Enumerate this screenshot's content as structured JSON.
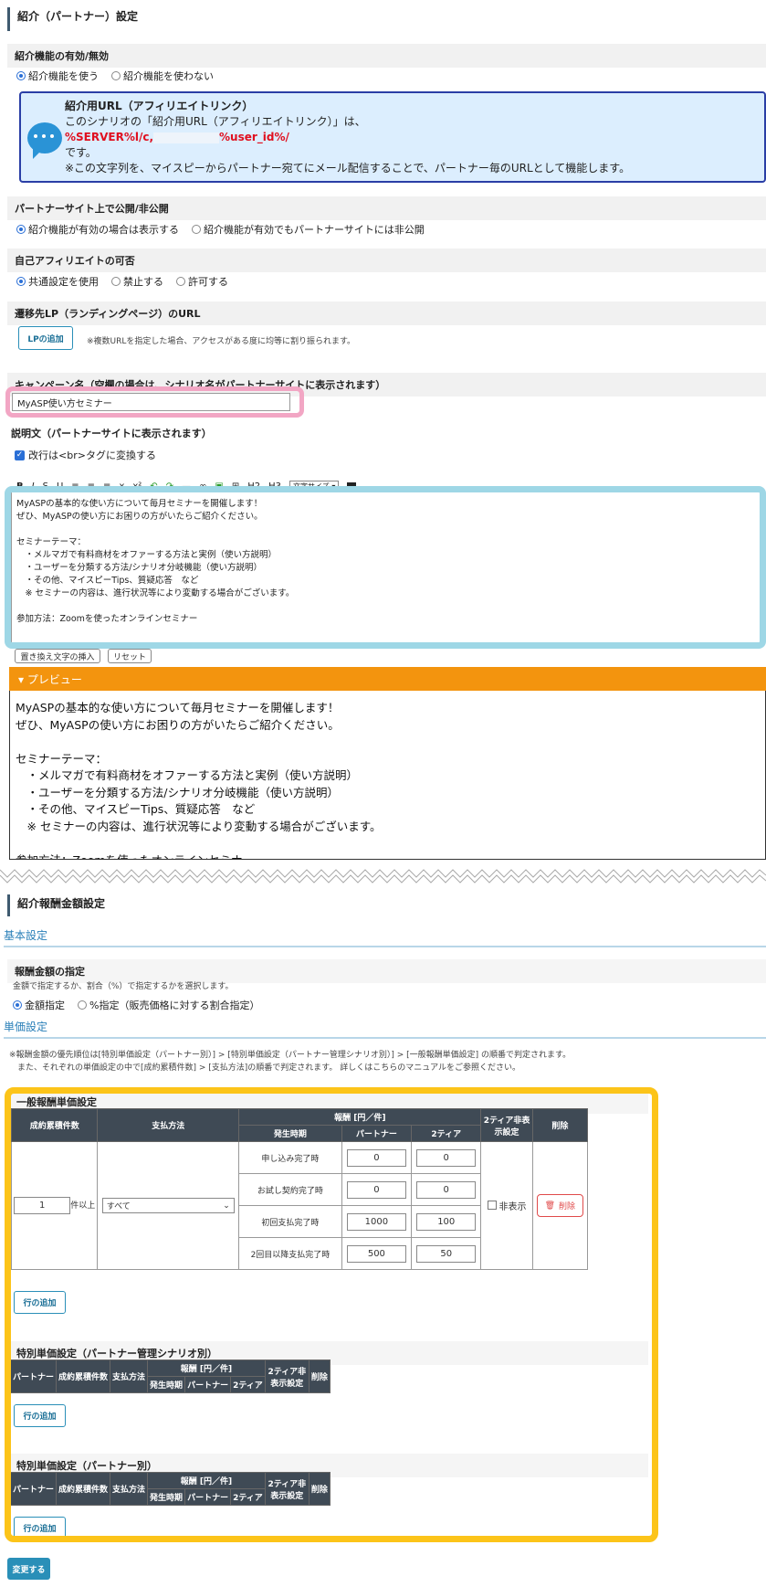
{
  "section1": {
    "title": "紹介（パートナー）設定",
    "enable": {
      "label": "紹介機能の有効/無効",
      "options": [
        "紹介機能を使う",
        "紹介機能を使わない"
      ],
      "selected": 0
    },
    "info": {
      "heading": "紹介用URL（アフィリエイトリンク）",
      "line1": "このシナリオの「紹介用URL（アフィリエイトリンク）」は、",
      "url_part1": "%SERVER%l/c,",
      "url_part2": "%user_id%/",
      "line3": "です。",
      "line4": "※この文字列を、マイスピーからパートナー宛てにメール配信することで、パートナー毎のURLとして機能します。"
    },
    "publish": {
      "label": "パートナーサイト上で公開/非公開",
      "options": [
        "紹介機能が有効の場合は表示する",
        "紹介機能が有効でもパートナーサイトには非公開"
      ],
      "selected": 0
    },
    "self_affiliate": {
      "label": "自己アフィリエイトの可否",
      "options": [
        "共通設定を使用",
        "禁止する",
        "許可する"
      ],
      "selected": 0
    },
    "lp": {
      "label": "遷移先LP（ランディングページ）のURL",
      "button": "LPの追加",
      "note": "※複数URLを指定した場合、アクセスがある度に均等に割り振られます。"
    },
    "campaign": {
      "label": "キャンペーン名（空欄の場合は、シナリオ名がパートナーサイトに表示されます）",
      "value": "MyASP使い方セミナー"
    },
    "description": {
      "label": "説明文（パートナーサイトに表示されます）",
      "br_checkbox": "改行は<br>タグに変換する",
      "toolbar": [
        "B",
        "I",
        "S",
        "U",
        "≡",
        "≡",
        "≡",
        "x",
        "x²",
        "↶",
        "↷",
        "—",
        "∞",
        "▣",
        "⊞",
        "H2",
        "H3"
      ],
      "font_select": "文字サイズ",
      "text": "MyASPの基本的な使い方について毎月セミナーを開催します！\nぜひ、MyASPの使い方にお困りの方がいたらご紹介ください。\n\nセミナーテーマ：\n　・メルマガで有料商材をオファーする方法と実例（使い方説明）\n　・ユーザーを分類する方法/シナリオ分岐機能（使い方説明）\n　・その他、マイスピーTips、質疑応答　など\n　※ セミナーの内容は、進行状況等により変動する場合がございます。\n\n参加方法：Zoomを使ったオンラインセミナー",
      "insert_button": "置き換え文字の挿入",
      "reset_button": "リセット"
    },
    "preview": {
      "title": "プレビュー",
      "text": "MyASPの基本的な使い方について毎月セミナーを開催します！\nぜひ、MyASPの使い方にお困りの方がいたらご紹介ください。\n\nセミナーテーマ：\n　・メルマガで有料商材をオファーする方法と実例（使い方説明）\n　・ユーザーを分類する方法/シナリオ分岐機能（使い方説明）\n　・その他、マイスピーTips、質疑応答　など\n　※ セミナーの内容は、進行状況等により変動する場合がございます。\n\n参加方法：Zoomを使ったオンラインセミナー"
    }
  },
  "section2": {
    "title": "紹介報酬金額設定",
    "basic_heading": "基本設定",
    "amount": {
      "label": "報酬金額の指定",
      "note": "金額で指定するか、割合（%）で指定するかを選択します。",
      "options": [
        "金額指定",
        "%指定（販売価格に対する割合指定）"
      ],
      "selected": 0
    },
    "unit_heading": "単価設定",
    "unit_note": "※報酬金額の優先順位は[特別単価設定（パートナー別）] > [特別単価設定（パートナー管理シナリオ別）] > [一般報酬単価設定] の順番で判定されます。\n　また、それぞれの単価設定の中で[成約累積件数] > [支払方法]の順番で判定されます。 詳しくはこちらのマニュアルをご参照ください。",
    "general": {
      "label": "一般報酬単価設定",
      "headers": {
        "count": "成約累積件数",
        "method": "支払方法",
        "reward": "報酬 [円／件]",
        "timing": "発生時期",
        "partner": "パートナー",
        "tier2": "2ティア",
        "hide": "2ティア非表示設定",
        "delete": "削除"
      },
      "count_value": "1",
      "count_suffix": "件以上",
      "method_value": "すべて",
      "rows": [
        {
          "timing": "申し込み完了時",
          "partner": "0",
          "tier2": "0"
        },
        {
          "timing": "お試し契約完了時",
          "partner": "0",
          "tier2": "0"
        },
        {
          "timing": "初回支払完了時",
          "partner": "1000",
          "tier2": "100"
        },
        {
          "timing": "2回目以降支払完了時",
          "partner": "500",
          "tier2": "50"
        }
      ],
      "hide_label": "非表示",
      "delete_label": "削除",
      "add_row": "行の追加"
    },
    "special_scenario": {
      "label": "特別単価設定（パートナー管理シナリオ別）",
      "headers": [
        "パートナー",
        "成約累積件数",
        "支払方法",
        "報酬 [円／件]",
        "発生時期",
        "パートナー",
        "2ティア",
        "2ティア非表示設定",
        "削除"
      ],
      "add_row": "行の追加"
    },
    "special_partner": {
      "label": "特別単価設定（パートナー別）",
      "headers": [
        "パートナー",
        "成約累積件数",
        "支払方法",
        "報酬 [円／件]",
        "発生時期",
        "パートナー",
        "2ティア",
        "2ティア非表示設定",
        "削除"
      ],
      "add_row": "行の追加"
    },
    "submit": "変更する"
  }
}
